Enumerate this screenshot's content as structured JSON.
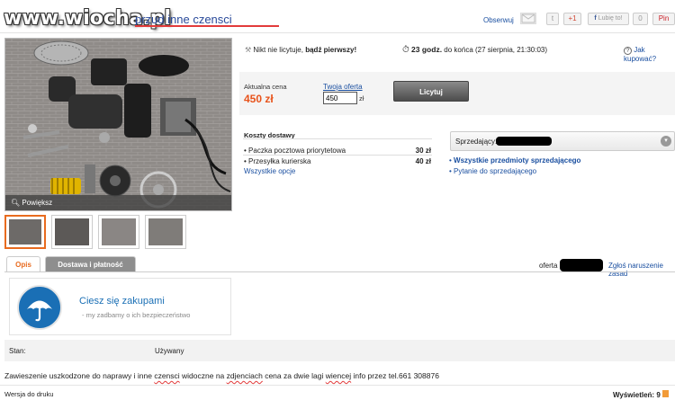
{
  "header": {
    "watermark": "www.wiocha.pl",
    "title": "przud inne czensci",
    "observe": "Obserwuj",
    "gplus": "+1",
    "like": "Lubię to!",
    "like_count": "0",
    "pin": "Pin"
  },
  "auction": {
    "no_bids": "Nikt nie licytuje,",
    "be_first": "bądź pierwszy!",
    "time_left_bold": "23 godz.",
    "time_left_rest": "do końca (27 sierpnia, 21:30:03)",
    "how_to_buy": "Jak kupować?",
    "current_price_label": "Aktualna cena",
    "current_price": "450 zł",
    "your_offer_label": "Twoja oferta",
    "bid_value": "450",
    "currency": "zł",
    "bid_button": "Licytuj"
  },
  "photo": {
    "zoom_label": "Powiększ",
    "thumbnails": [
      "thumb-1",
      "thumb-2",
      "thumb-3",
      "thumb-4"
    ]
  },
  "shipping": {
    "title": "Koszty dostawy",
    "options": [
      {
        "name": "Paczka pocztowa priorytetowa",
        "price": "30 zł"
      },
      {
        "name": "Przesyłka kurierska",
        "price": "40 zł"
      }
    ],
    "all_options": "Wszystkie opcje"
  },
  "seller": {
    "label": "Sprzedający:",
    "all_items": "Wszystkie przedmioty sprzedającego",
    "ask": "Pytanie do sprzedającego"
  },
  "tabs": {
    "description": "Opis",
    "delivery": "Dostawa i płatność",
    "offer_label": "oferta",
    "report": "Zgłoś naruszenie zasad"
  },
  "safety": {
    "title": "Ciesz się zakupami",
    "subtitle": "my zadbamy o ich bezpieczeństwo"
  },
  "details": {
    "state_label": "Stan:",
    "state_value": "Używany"
  },
  "description": {
    "part1": "Zawieszenie uszkodzone do naprawy i inne ",
    "word1": "czensci",
    "part2": " widoczne na ",
    "word2": "zdjenciach",
    "part3": " cena za dwie lagi ",
    "word3": "wiencej",
    "part4": " info przez tel.661 308876"
  },
  "footer": {
    "print_version": "Wersja do druku",
    "views_label": "Wyświetleń:",
    "views_count": "9"
  },
  "colors": {
    "accent": "#e86b1f",
    "link": "#1a4fa0",
    "safety_blue": "#1a6fb5"
  }
}
